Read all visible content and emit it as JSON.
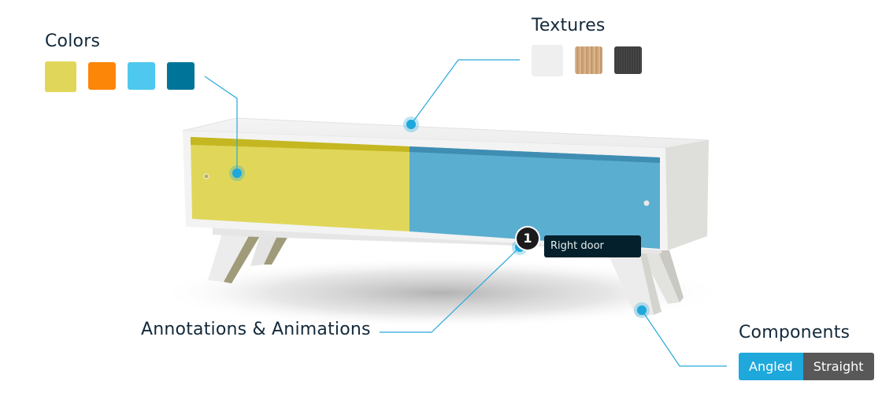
{
  "colors": {
    "label": "Colors",
    "swatches": [
      {
        "name": "yellow",
        "hex": "#e0d75a"
      },
      {
        "name": "orange",
        "hex": "#fc8608"
      },
      {
        "name": "light-blue",
        "hex": "#4ec8ef"
      },
      {
        "name": "dark-blue",
        "hex": "#007599"
      }
    ]
  },
  "textures": {
    "label": "Textures",
    "swatches": [
      {
        "name": "white",
        "hex": "#efefef"
      },
      {
        "name": "wood",
        "hex": "#d1a677"
      },
      {
        "name": "dark-wood",
        "hex": "#3c3c3c"
      }
    ]
  },
  "annotations": {
    "label": "Annotations & Animations",
    "badge_number": "1",
    "tooltip": "Right door"
  },
  "components": {
    "label": "Components",
    "options": [
      "Angled",
      "Straight"
    ],
    "selected": "Angled"
  },
  "theme": {
    "accent": "#1ea8dc",
    "left_door": "#e0d75a",
    "right_door": "#5aaed0"
  }
}
